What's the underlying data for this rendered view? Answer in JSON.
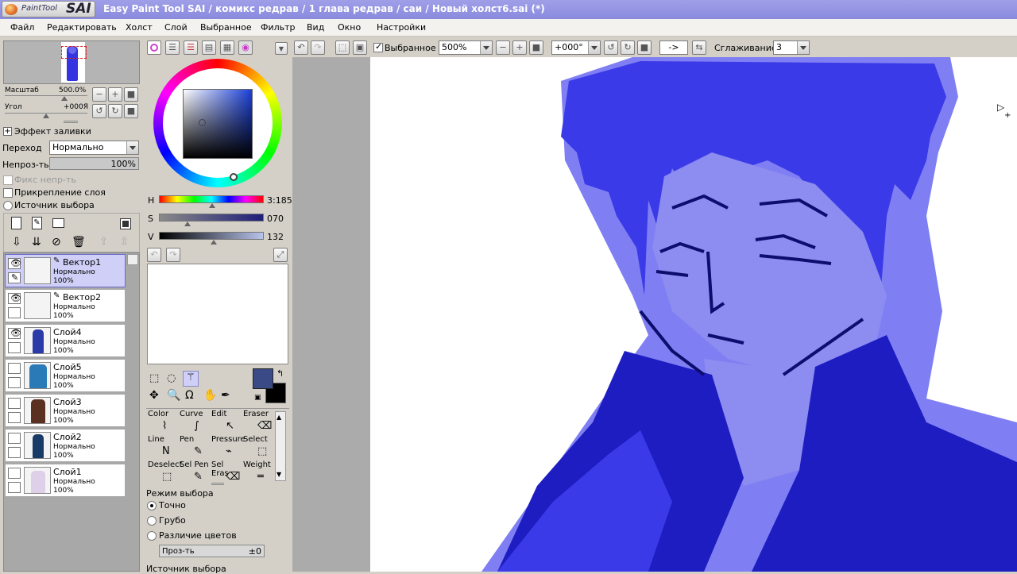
{
  "app": {
    "logo_text": "PaintTool",
    "logo_brand": "SAI",
    "title": "Easy Paint Tool SAI / комикс редрав /   1 глава редрав / саи / Новый холст6.sai (*)"
  },
  "menu": [
    "Файл",
    "Редактировать",
    "Холст",
    "Слой",
    "Выбранное",
    "Фильтр",
    "Вид",
    "Окно",
    "Настройки"
  ],
  "toolbar": {
    "selection_label": "Выбранное",
    "selection_checked": true,
    "zoom": "500%",
    "angle": "+000°",
    "flip_label": "->",
    "smoothing_label": "Сглаживание",
    "smoothing_value": "3"
  },
  "navigator": {
    "scale_label": "Масштаб",
    "scale_value": "500.0%",
    "angle_label": "Угол",
    "angle_value": "+000Я"
  },
  "layer_props": {
    "fill_effect": "Эффект заливки",
    "blend_label": "Переход",
    "blend_value": "Нормально",
    "opacity_label": "Непроз-ть",
    "opacity_value": "100%",
    "opacity_fraction": 1.0,
    "fix_opacity": "Фикс непр-ть",
    "clip_layer": "Прикрепление слоя",
    "selection_source": "Источник выбора"
  },
  "layers": [
    {
      "name": "Вектор1",
      "mode": "Нормально",
      "opacity": "100%",
      "visible": true,
      "selected": true,
      "vector": true
    },
    {
      "name": "Вектор2",
      "mode": "Нормально",
      "opacity": "100%",
      "visible": true,
      "selected": false,
      "vector": true
    },
    {
      "name": "Слой4",
      "mode": "Нормально",
      "opacity": "100%",
      "visible": true,
      "selected": false,
      "vector": false
    },
    {
      "name": "Слой5",
      "mode": "Нормально",
      "opacity": "100%",
      "visible": false,
      "selected": false,
      "vector": false
    },
    {
      "name": "Слой3",
      "mode": "Нормально",
      "opacity": "100%",
      "visible": false,
      "selected": false,
      "vector": false
    },
    {
      "name": "Слой2",
      "mode": "Нормально",
      "opacity": "100%",
      "visible": false,
      "selected": false,
      "vector": false
    },
    {
      "name": "Слой1",
      "mode": "Нормально",
      "opacity": "100%",
      "visible": false,
      "selected": false,
      "vector": false
    }
  ],
  "color": {
    "h_label": "H",
    "h_value": "3:185",
    "s_label": "S",
    "s_value": "070",
    "v_label": "V",
    "v_value": "132",
    "h_fraction": 0.51,
    "s_fraction": 0.27,
    "v_fraction": 0.52,
    "primary": "#3a4a86",
    "secondary": "#000000"
  },
  "brushes": [
    {
      "label": "Color",
      "icon": "color-brush-icon"
    },
    {
      "label": "Curve",
      "icon": "curve-icon"
    },
    {
      "label": "Edit",
      "icon": "edit-arrow-icon"
    },
    {
      "label": "Eraser",
      "icon": "eraser-icon"
    },
    {
      "label": "Line",
      "icon": "line-icon"
    },
    {
      "label": "Pen",
      "icon": "pen-icon"
    },
    {
      "label": "Pressure",
      "icon": "pressure-icon"
    },
    {
      "label": "Select",
      "icon": "select-icon"
    },
    {
      "label": "Deselect",
      "icon": "deselect-icon"
    },
    {
      "label": "Sel Pen",
      "icon": "sel-pen-icon"
    },
    {
      "label": "Sel Eras",
      "icon": "sel-eraser-icon"
    },
    {
      "label": "Weight",
      "icon": "weight-icon"
    }
  ],
  "selection_mode": {
    "title": "Режим выбора",
    "options": [
      "Точно",
      "Грубо",
      "Различие цветов"
    ],
    "selected": 0,
    "tolerance_label": "Проз-ть",
    "tolerance_value": "±0",
    "source_label": "Источник выбора"
  },
  "canvas_colors": {
    "light": "#7f7ff3",
    "mid": "#3a3ae8",
    "dark": "#1d1dc2",
    "line": "#0d0d6e",
    "skin": "#8c8cf1"
  }
}
